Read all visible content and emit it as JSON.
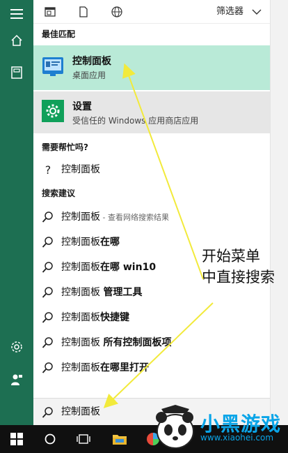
{
  "filter": {
    "label": "筛选器"
  },
  "sections": {
    "best_match": "最佳匹配",
    "need_help": "需要帮忙吗?",
    "suggestions": "搜索建议"
  },
  "best_match_items": [
    {
      "title": "控制面板",
      "subtitle": "桌面应用",
      "icon": "control-panel-icon"
    },
    {
      "title": "设置",
      "subtitle": "受信任的 Windows 应用商店应用",
      "icon": "settings-gear-icon"
    }
  ],
  "help_items": [
    {
      "label": "控制面板"
    }
  ],
  "suggestion_items": [
    {
      "main": "控制面板",
      "bold": "",
      "sub": " - 查看网络搜索结果"
    },
    {
      "main": "控制面板",
      "bold": "在哪",
      "sub": ""
    },
    {
      "main": "控制面板",
      "bold": "在哪 win10",
      "sub": ""
    },
    {
      "main": "控制面板 ",
      "bold": "管理工具",
      "sub": ""
    },
    {
      "main": "控制面板",
      "bold": "快捷键",
      "sub": ""
    },
    {
      "main": "控制面板 ",
      "bold": "所有控制面板项",
      "sub": ""
    },
    {
      "main": "控制面板",
      "bold": "在哪里打开",
      "sub": ""
    }
  ],
  "search": {
    "value": "控制面板"
  },
  "annotation": {
    "line1": "开始菜单",
    "line2": "中直接搜索"
  },
  "watermark": {
    "brand": "小黑游戏",
    "url": "www.xiaohei.com"
  },
  "colors": {
    "sidebar": "#1d6f52",
    "highlight": "#b9ead7",
    "settings_row": "#e6e6e6",
    "tile_blue": "#1e7fd0",
    "settings_tile": "#10a05a",
    "arrow": "#f2ea3b"
  }
}
